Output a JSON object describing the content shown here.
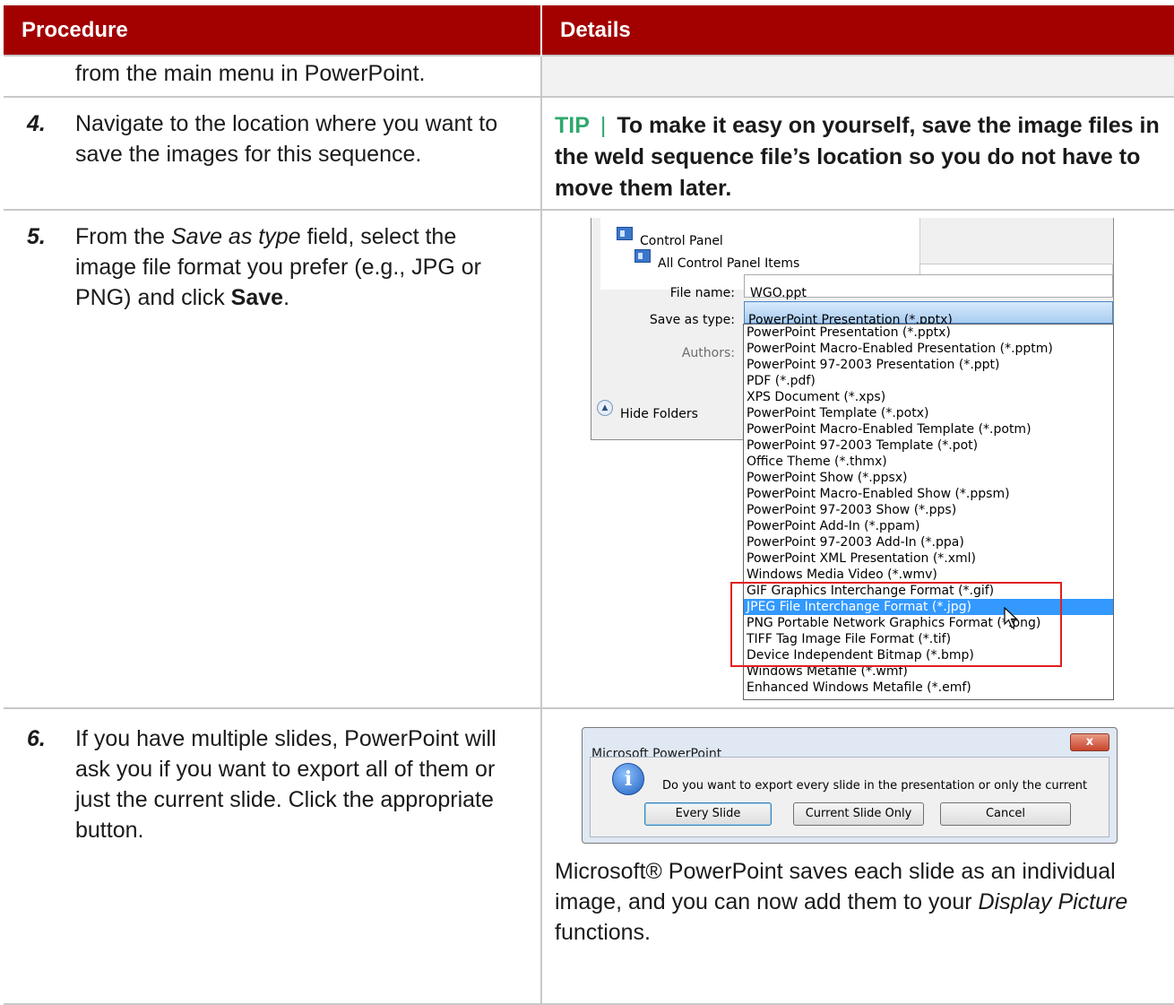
{
  "table": {
    "headers": [
      "Procedure",
      "Details"
    ]
  },
  "rows": {
    "continuation": "from the main menu in PowerPoint.",
    "step4": {
      "num": "4.",
      "text": "Navigate to the location where you want to save the images for this sequence.",
      "tip_label": "TIP",
      "tip_separator": "|",
      "tip_text": "To make it easy on yourself, save the image files in the weld sequence file’s location so you do not have to move them later."
    },
    "step5": {
      "num": "5.",
      "text_pre": "From the",
      "text_italic": "Save as type",
      "text_mid": "field, select the image file format you prefer (e.g., JPG or PNG) and click",
      "text_bold": "Save",
      "text_end": "."
    },
    "step6": {
      "num": "6.",
      "text": "If you have multiple slides, PowerPoint will ask you if you want to export all of them or just the current slide.  Click the appropriate button.",
      "after_pre": "Microsoft® PowerPoint saves each slide as an individual image, and you can now add them to your",
      "after_italic": "Display Picture",
      "after_end": "functions."
    }
  },
  "save_dialog": {
    "nav_items": [
      "Control Panel",
      "All Control Panel Items"
    ],
    "file_name_label": "File name:",
    "file_name_value": "WGO.ppt",
    "save_as_type_label": "Save as type:",
    "save_as_type_value": "PowerPoint Presentation (*.pptx)",
    "authors_label": "Authors:",
    "hide_folders": "Hide Folders",
    "type_options": [
      "PowerPoint Presentation (*.pptx)",
      "PowerPoint Macro-Enabled Presentation (*.pptm)",
      "PowerPoint 97-2003 Presentation (*.ppt)",
      "PDF (*.pdf)",
      "XPS Document (*.xps)",
      "PowerPoint Template (*.potx)",
      "PowerPoint Macro-Enabled Template (*.potm)",
      "PowerPoint 97-2003 Template (*.pot)",
      "Office Theme (*.thmx)",
      "PowerPoint Show (*.ppsx)",
      "PowerPoint Macro-Enabled Show (*.ppsm)",
      "PowerPoint 97-2003 Show (*.pps)",
      "PowerPoint Add-In (*.ppam)",
      "PowerPoint 97-2003 Add-In (*.ppa)",
      "PowerPoint XML Presentation (*.xml)",
      "Windows Media Video (*.wmv)",
      "GIF Graphics Interchange Format (*.gif)",
      "JPEG File Interchange Format (*.jpg)",
      "PNG Portable Network Graphics Format (*.png)",
      "TIFF Tag Image File Format (*.tif)",
      "Device Independent Bitmap (*.bmp)",
      "Windows Metafile (*.wmf)",
      "Enhanced Windows Metafile (*.emf)"
    ],
    "selected_option": "JPEG File Interchange Format (*.jpg)"
  },
  "ppt_prompt": {
    "title": "Microsoft PowerPoint",
    "close": "x",
    "message": "Do you want to export every slide in the presentation or only the current slide?",
    "buttons": [
      "Every Slide",
      "Current Slide Only",
      "Cancel"
    ]
  },
  "colors": {
    "header_bg": "#a30000",
    "tip_green": "#2ea86d",
    "highlight_red": "#e02020",
    "selection_blue": "#3399ff"
  }
}
